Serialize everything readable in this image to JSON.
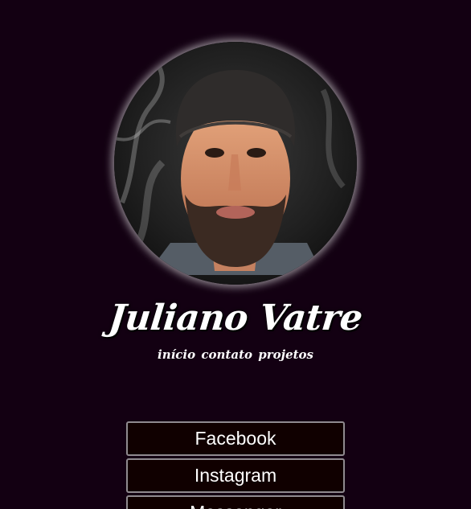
{
  "profile": {
    "name": "Juliano Vatre",
    "avatar_alt": "profile-photo"
  },
  "nav": {
    "items": [
      "início",
      "contato",
      "projetos"
    ]
  },
  "links": [
    "Facebook",
    "Instagram",
    "Messenger"
  ],
  "colors": {
    "background": "#130012",
    "button_bg": "#100000",
    "button_border": "#8f8a8f",
    "text": "#ffffff"
  }
}
